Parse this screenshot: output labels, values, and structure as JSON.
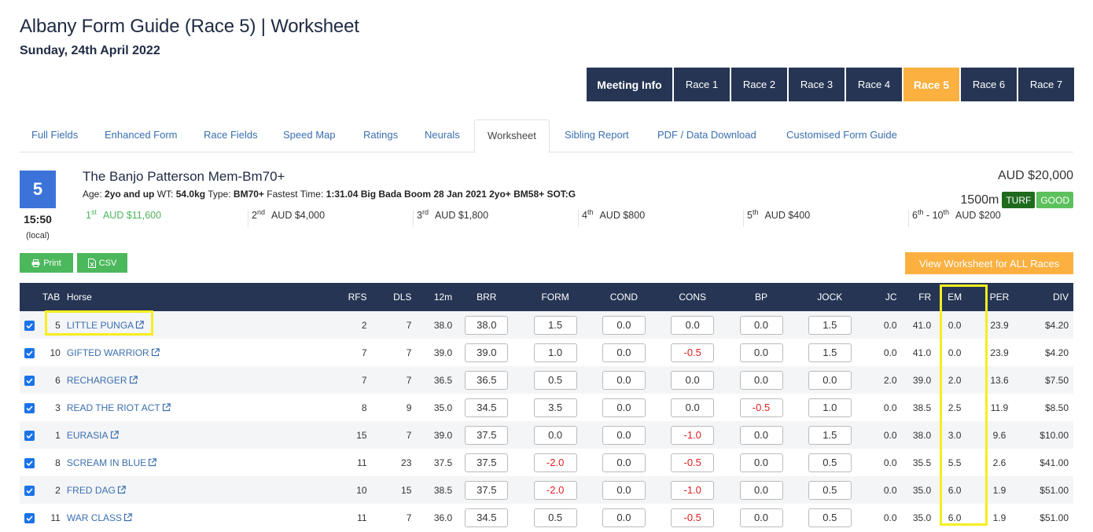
{
  "page": {
    "title": "Albany Form Guide (Race 5) | Worksheet",
    "date": "Sunday, 24th April 2022"
  },
  "race_nav": {
    "meeting": "Meeting Info",
    "races": [
      "Race 1",
      "Race 2",
      "Race 3",
      "Race 4",
      "Race 5",
      "Race 6",
      "Race 7"
    ],
    "active": "Race 5"
  },
  "tabs": [
    "Full Fields",
    "Enhanced Form",
    "Race Fields",
    "Speed Map",
    "Ratings",
    "Neurals",
    "Worksheet",
    "Sibling Report",
    "PDF / Data Download",
    "Customised Form Guide"
  ],
  "active_tab": "Worksheet",
  "race": {
    "number": "5",
    "time": "15:50",
    "local": "(local)",
    "name": "The Banjo Patterson Mem-Bm70+",
    "age_label": "Age:",
    "age": "2yo and up",
    "wt_label": "WT:",
    "wt": "54.0kg",
    "type_label": "Type:",
    "type": "BM70+",
    "fastest_label": "Fastest Time:",
    "fastest": "1:31.04 Big Bada Boom 28 Jan 2021 2yo+ BM58+ SOT:G",
    "total_prize": "AUD $20,000",
    "distance": "1500m",
    "surface": "TURF",
    "condition": "GOOD",
    "prizes": [
      {
        "place": "1",
        "suffix": "st",
        "place_end": "",
        "suffix_end": "",
        "amount": "AUD $11,600"
      },
      {
        "place": "2",
        "suffix": "nd",
        "place_end": "",
        "suffix_end": "",
        "amount": "AUD $4,000"
      },
      {
        "place": "3",
        "suffix": "rd",
        "place_end": "",
        "suffix_end": "",
        "amount": "AUD $1,800"
      },
      {
        "place": "4",
        "suffix": "th",
        "place_end": "",
        "suffix_end": "",
        "amount": "AUD $800"
      },
      {
        "place": "5",
        "suffix": "th",
        "place_end": "",
        "suffix_end": "",
        "amount": "AUD $400"
      },
      {
        "place": "6",
        "suffix": "th",
        "place_end": " - 10",
        "suffix_end": "th",
        "amount": "AUD $200"
      }
    ]
  },
  "actions": {
    "print": "Print",
    "csv": "CSV",
    "view_all": "View Worksheet for ALL Races"
  },
  "table": {
    "headers": [
      "TAB",
      "Horse",
      "RFS",
      "DLS",
      "12m",
      "BRR",
      "FORM",
      "COND",
      "CONS",
      "BP",
      "JOCK",
      "JC",
      "FR",
      "EM",
      "PER",
      "DIV"
    ],
    "rows": [
      {
        "tab": "5",
        "horse": "LITTLE PUNGA",
        "rfs": "2",
        "dls": "7",
        "m12": "38.0",
        "brr": "38.0",
        "form": "1.5",
        "cond": "0.0",
        "cons": "0.0",
        "bp": "0.0",
        "jock": "1.5",
        "jc": "0.0",
        "fr": "41.0",
        "em": "0.0",
        "per": "23.9",
        "div": "$4.20"
      },
      {
        "tab": "10",
        "horse": "GIFTED WARRIOR",
        "rfs": "7",
        "dls": "7",
        "m12": "39.0",
        "brr": "39.0",
        "form": "1.0",
        "cond": "0.0",
        "cons": "-0.5",
        "bp": "0.0",
        "jock": "1.5",
        "jc": "0.0",
        "fr": "41.0",
        "em": "0.0",
        "per": "23.9",
        "div": "$4.20"
      },
      {
        "tab": "6",
        "horse": "RECHARGER",
        "rfs": "7",
        "dls": "7",
        "m12": "36.5",
        "brr": "36.5",
        "form": "0.5",
        "cond": "0.0",
        "cons": "0.0",
        "bp": "0.0",
        "jock": "0.0",
        "jc": "2.0",
        "fr": "39.0",
        "em": "2.0",
        "per": "13.6",
        "div": "$7.50"
      },
      {
        "tab": "3",
        "horse": "READ THE RIOT ACT",
        "rfs": "8",
        "dls": "9",
        "m12": "35.0",
        "brr": "34.5",
        "form": "3.5",
        "cond": "0.0",
        "cons": "0.0",
        "bp": "-0.5",
        "jock": "1.0",
        "jc": "0.0",
        "fr": "38.5",
        "em": "2.5",
        "per": "11.9",
        "div": "$8.50"
      },
      {
        "tab": "1",
        "horse": "EURASIA",
        "rfs": "15",
        "dls": "7",
        "m12": "39.0",
        "brr": "37.5",
        "form": "0.0",
        "cond": "0.0",
        "cons": "-1.0",
        "bp": "0.0",
        "jock": "1.5",
        "jc": "0.0",
        "fr": "38.0",
        "em": "3.0",
        "per": "9.6",
        "div": "$10.00"
      },
      {
        "tab": "8",
        "horse": "SCREAM IN BLUE",
        "rfs": "11",
        "dls": "23",
        "m12": "37.5",
        "brr": "37.5",
        "form": "-2.0",
        "cond": "0.0",
        "cons": "-0.5",
        "bp": "0.0",
        "jock": "0.5",
        "jc": "0.0",
        "fr": "35.5",
        "em": "5.5",
        "per": "2.6",
        "div": "$41.00"
      },
      {
        "tab": "2",
        "horse": "FRED DAG",
        "rfs": "10",
        "dls": "15",
        "m12": "38.5",
        "brr": "37.5",
        "form": "-2.0",
        "cond": "0.0",
        "cons": "-1.0",
        "bp": "0.0",
        "jock": "0.5",
        "jc": "0.0",
        "fr": "35.0",
        "em": "6.0",
        "per": "1.9",
        "div": "$51.00"
      },
      {
        "tab": "11",
        "horse": "WAR CLASS",
        "rfs": "11",
        "dls": "7",
        "m12": "36.0",
        "brr": "34.5",
        "form": "0.5",
        "cond": "0.0",
        "cons": "-0.5",
        "bp": "0.0",
        "jock": "0.5",
        "jc": "0.0",
        "fr": "35.0",
        "em": "6.0",
        "per": "1.9",
        "div": "$51.00"
      }
    ]
  },
  "colors": {
    "navy": "#263554",
    "accent_orange": "#fbb040",
    "race_blue": "#3b73d9",
    "button_green": "#4cb85c",
    "negative_red": "#e02020",
    "highlight_yellow": "#f5ee20"
  },
  "icons": {
    "print": "printer-icon",
    "csv": "file-excel-icon",
    "external": "external-link-icon",
    "checkbox": "checkbox-checked-icon"
  }
}
